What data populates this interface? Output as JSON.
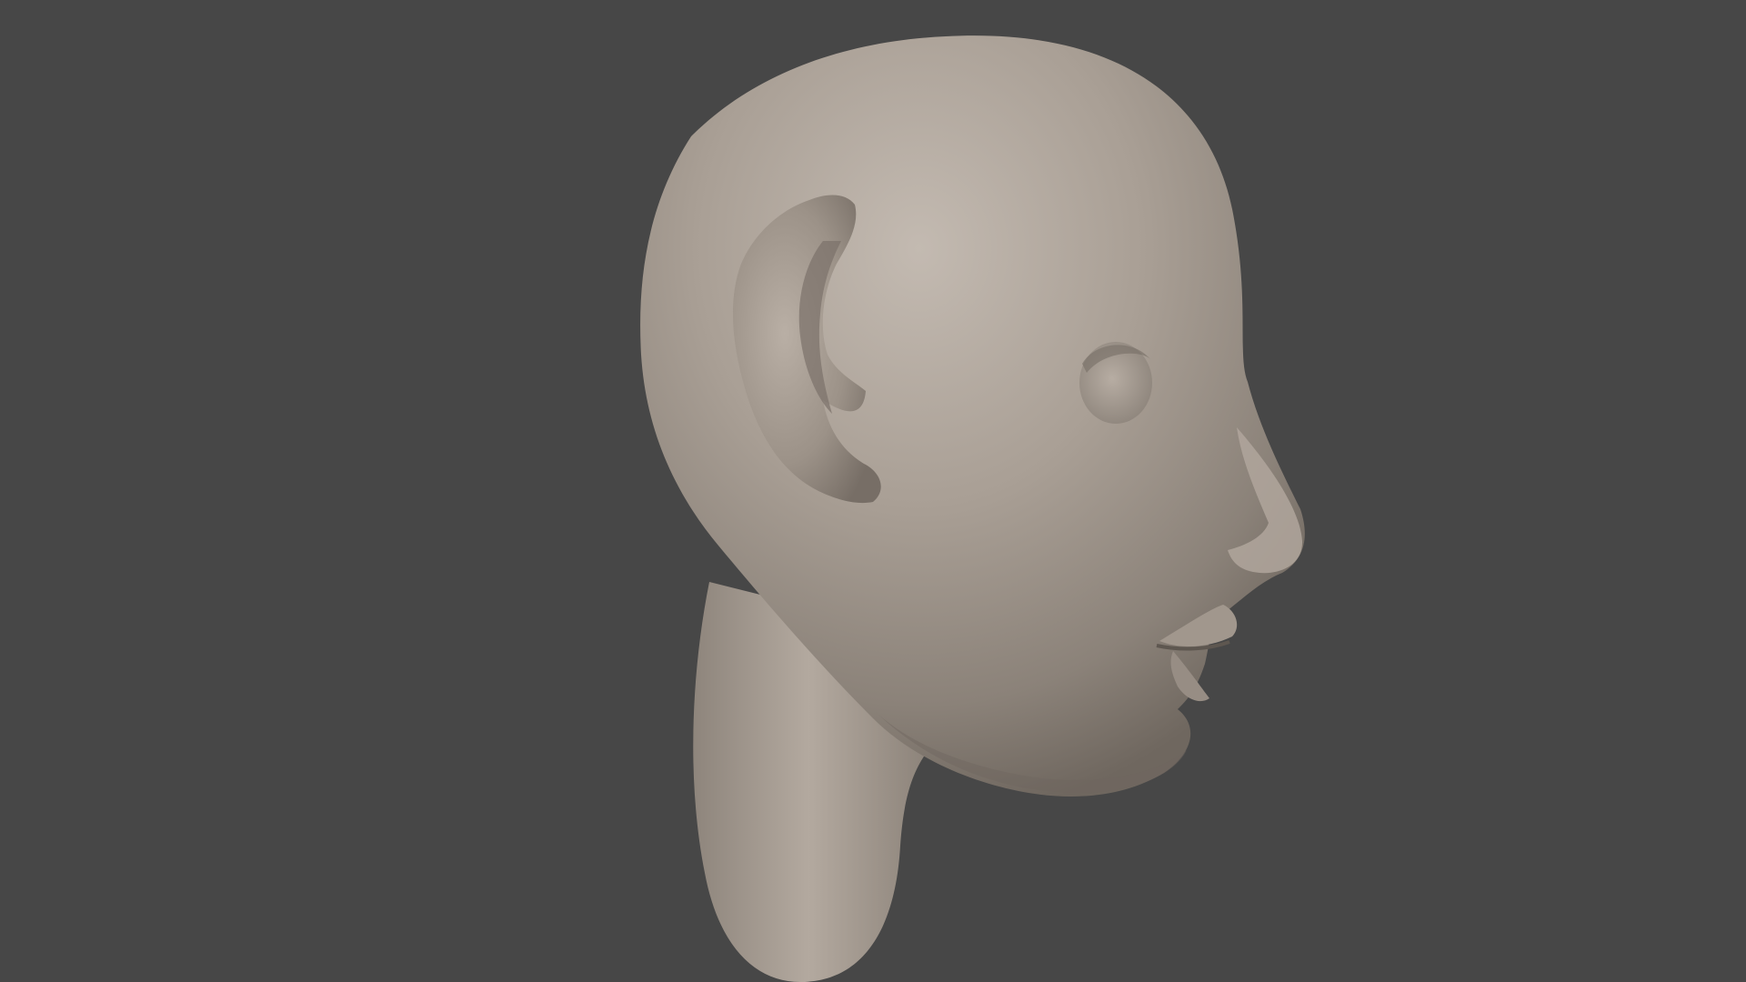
{
  "viewport": {
    "background_color": "#474747"
  },
  "sculpt": {
    "subject": "head-sculpt",
    "base_color": "#9f958b",
    "highlight_color": "#c3bab1",
    "shadow_color": "#6f675f"
  }
}
